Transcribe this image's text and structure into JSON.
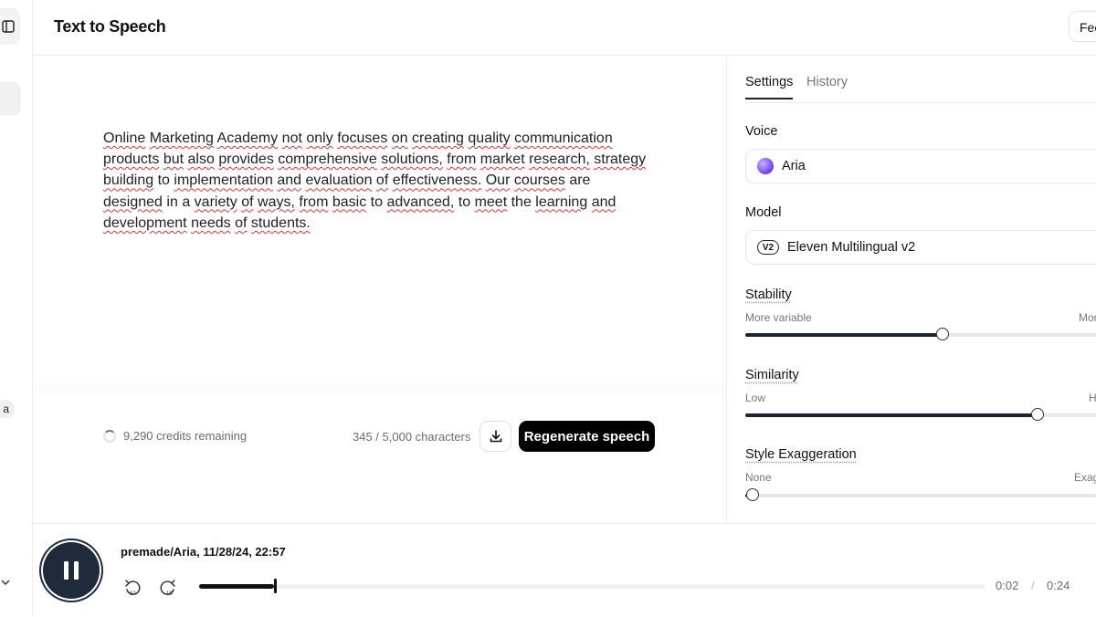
{
  "header": {
    "title": "Text to Speech",
    "feedback_label": "Feedback"
  },
  "sidebar": {
    "pill_text": "a"
  },
  "editor": {
    "text_words": [
      "Online",
      "Marketing",
      "Academy",
      "not",
      "only",
      "focuses",
      "on",
      "creating",
      "quality",
      "communication",
      "products",
      "but",
      "also",
      "provides",
      "comprehensive",
      "solutions,",
      "from",
      "market",
      "research,",
      "strategy",
      "building",
      "to",
      "implementation",
      "and",
      "evaluation",
      "of",
      "effectiveness.",
      "Our",
      "courses",
      "are",
      "designed",
      "in",
      "a",
      "variety",
      "of",
      "ways,",
      "from",
      "basic",
      "to",
      "advanced,",
      "to",
      "meet",
      "the",
      "learning",
      "and",
      "development",
      "needs",
      "of",
      "students."
    ],
    "misspelled_flags": [
      1,
      1,
      1,
      1,
      1,
      1,
      1,
      1,
      1,
      1,
      1,
      1,
      1,
      1,
      1,
      1,
      1,
      1,
      1,
      1,
      1,
      0,
      1,
      1,
      1,
      1,
      1,
      1,
      1,
      0,
      1,
      0,
      0,
      1,
      1,
      1,
      1,
      1,
      0,
      1,
      0,
      1,
      0,
      1,
      1,
      1,
      1,
      1,
      1
    ],
    "credits": "9,290 credits remaining",
    "char_count": "345 / 5,000 characters",
    "regenerate_label": "Regenerate speech"
  },
  "settings": {
    "tabs": [
      {
        "label": "Settings",
        "active": true
      },
      {
        "label": "History",
        "active": false
      }
    ],
    "voice": {
      "label": "Voice",
      "value": "Aria"
    },
    "model": {
      "label": "Model",
      "badge": "V2",
      "value": "Eleven Multilingual v2"
    },
    "stability": {
      "label": "Stability",
      "min_label": "More variable",
      "max_label": "More stable",
      "value": 0.54
    },
    "similarity": {
      "label": "Similarity",
      "min_label": "Low",
      "max_label": "High",
      "value": 0.8
    },
    "style": {
      "label": "Style Exaggeration",
      "min_label": "None",
      "max_label": "Exaggerated",
      "value": 0.02
    }
  },
  "player": {
    "title": "premade/Aria, 11/28/24, 22:57",
    "current_time": "0:02",
    "separator": "/",
    "total_time": "0:24",
    "progress": 0.095
  },
  "colors": {
    "accent_dark": "#1f2a3a",
    "primary_button": "#000000",
    "spell_underline": "#dd3333"
  }
}
